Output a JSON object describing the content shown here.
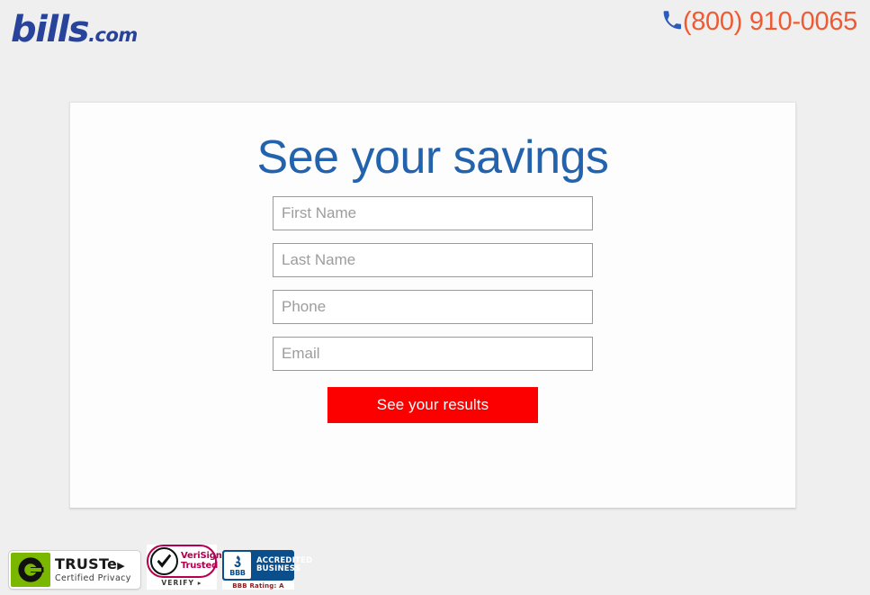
{
  "page": {
    "background_color": "#efefef",
    "accent_blue": "#2363ad",
    "brand_blue": "#27449a",
    "phone_orange": "#f05a32",
    "cta_red": "#fc0000"
  },
  "header": {
    "logo_main": "bills",
    "logo_suffix": ".com",
    "phone_icon": "phone-handset-icon",
    "phone_number": "(800) 910-0065"
  },
  "card": {
    "title": "See your savings",
    "fields": [
      {
        "name": "first-name",
        "placeholder": "First Name",
        "value": "",
        "type": "text"
      },
      {
        "name": "last-name",
        "placeholder": "Last Name",
        "value": "",
        "type": "text"
      },
      {
        "name": "phone",
        "placeholder": "Phone",
        "value": "",
        "type": "tel"
      },
      {
        "name": "email",
        "placeholder": "Email",
        "value": "",
        "type": "email"
      }
    ],
    "submit_label": "See your results"
  },
  "badges": {
    "truste": {
      "icon": "truste-e-logo-icon",
      "title": "TRUSTe",
      "caret": "▶",
      "subtitle": "Certified Privacy"
    },
    "verisign": {
      "icon": "checkmark-icon",
      "line1": "VeriSign",
      "line2": "Trusted",
      "verify": "VERIFY ▸"
    },
    "bbb": {
      "icon": "bbb-torch-icon",
      "seal_word": "BBB",
      "line1": "ACCREDITED",
      "line2": "BUSINESS",
      "rating": "BBB Rating: A"
    }
  }
}
